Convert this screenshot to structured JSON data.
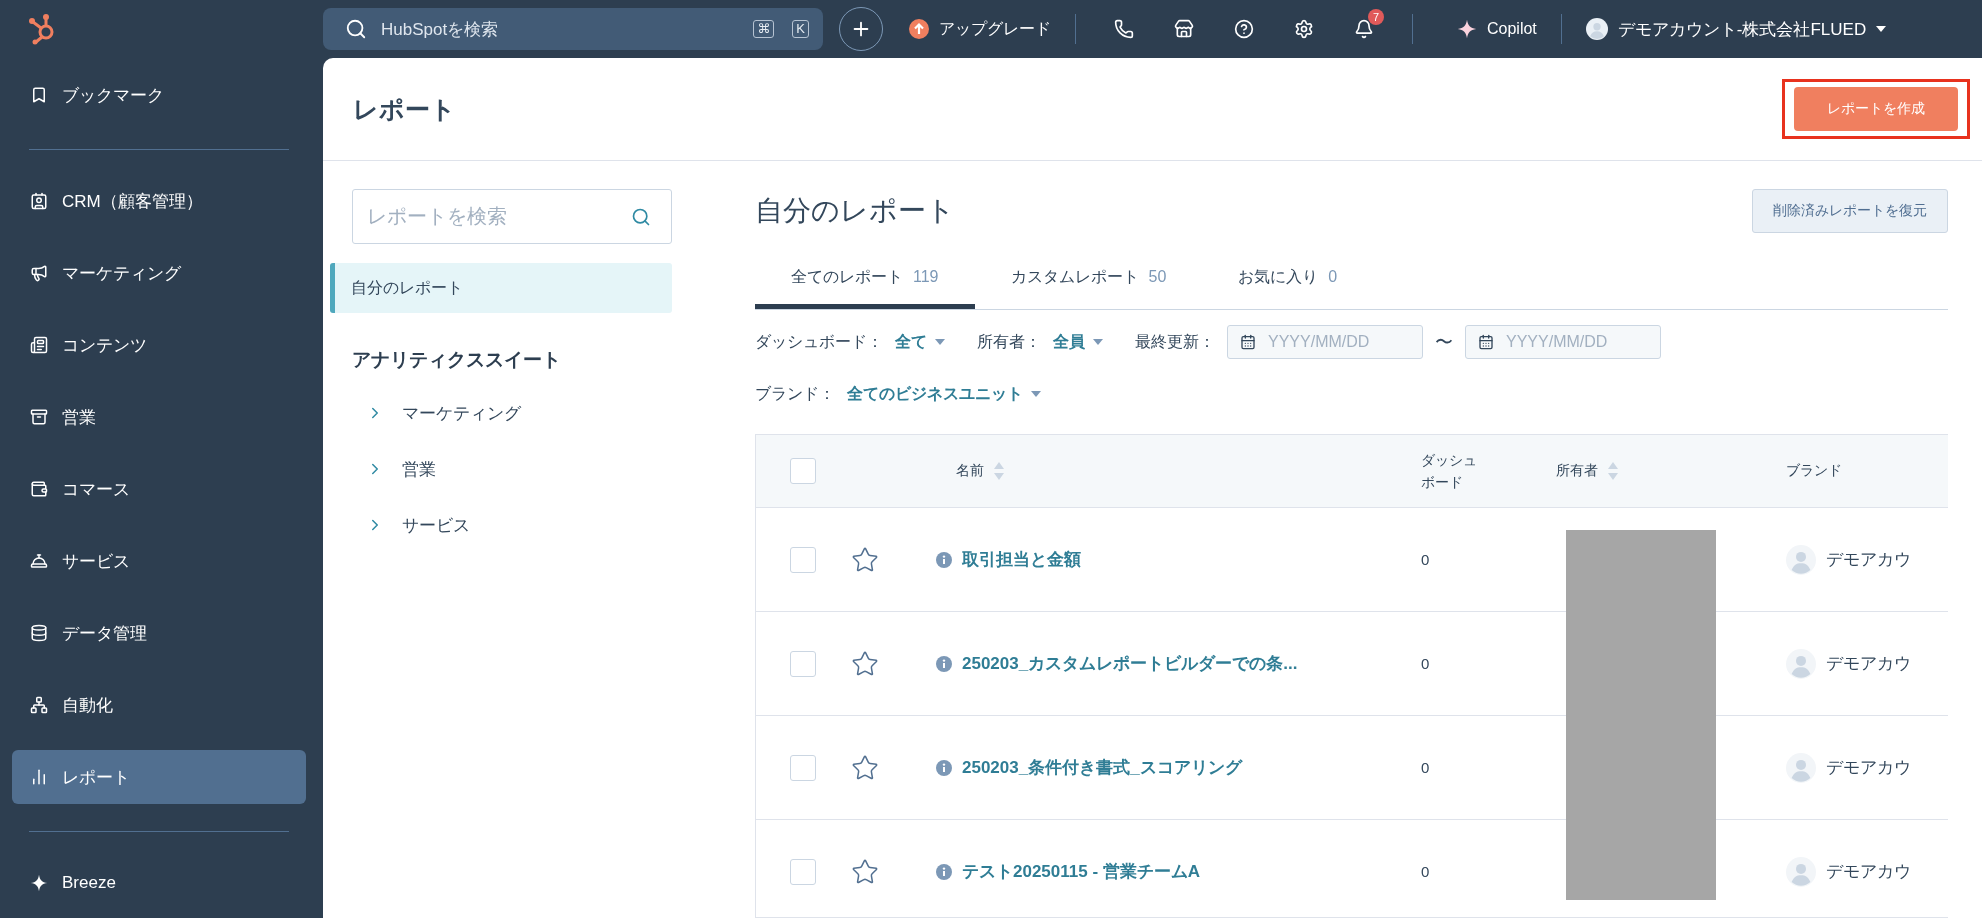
{
  "topbar": {
    "search": {
      "placeholder": "HubSpotを検索",
      "keys": [
        "⌘",
        "K"
      ]
    },
    "upgrade": "アップグレード",
    "notifications": "7",
    "copilot": "Copilot",
    "account": "デモアカウント-株式会社FLUED"
  },
  "sidebar": {
    "sections": [
      {
        "items": [
          {
            "label": "ブックマーク",
            "selected": false
          }
        ]
      },
      {
        "items": [
          {
            "label": "CRM（顧客管理）",
            "selected": false
          },
          {
            "label": "マーケティング",
            "selected": false
          },
          {
            "label": "コンテンツ",
            "selected": false
          },
          {
            "label": "営業",
            "selected": false
          },
          {
            "label": "コマース",
            "selected": false
          },
          {
            "label": "サービス",
            "selected": false
          },
          {
            "label": "データ管理",
            "selected": false
          },
          {
            "label": "自動化",
            "selected": false
          },
          {
            "label": "レポート",
            "selected": true
          }
        ]
      },
      {
        "items": [
          {
            "label": "Breeze",
            "selected": false
          }
        ]
      }
    ]
  },
  "page": {
    "title": "レポート",
    "create_button": {
      "label": "レポートを作成",
      "highlighted": true
    }
  },
  "left_panel": {
    "search": {
      "placeholder": "レポートを検索"
    },
    "nav": [
      {
        "label": "自分のレポート",
        "selected": true
      }
    ],
    "section_title": "アナリティクススイート",
    "tree": [
      {
        "label": "マーケティング",
        "expanded": false
      },
      {
        "label": "営業",
        "expanded": false
      },
      {
        "label": "サービス",
        "expanded": false
      }
    ]
  },
  "content": {
    "title": "自分のレポート",
    "restore_button": "削除済みレポートを復元",
    "tabs": [
      {
        "label": "全てのレポート",
        "count": "119",
        "selected": true
      },
      {
        "label": "カスタムレポート",
        "count": "50",
        "selected": false
      },
      {
        "label": "お気に入り",
        "count": "0",
        "selected": false
      }
    ],
    "filters": [
      {
        "label": "ダッシュボード：",
        "value": "全て"
      },
      {
        "label": "所有者：",
        "value": "全員"
      }
    ],
    "date_filter": {
      "label": "最終更新：",
      "from_placeholder": "YYYY/MM/DD",
      "separator": "〜",
      "to_placeholder": "YYYY/MM/DD"
    },
    "brand_filter": {
      "label": "ブランド：",
      "value": "全てのビジネスユニット"
    },
    "table": {
      "header_checked": false,
      "columns": [
        {
          "label": "名前",
          "sortable": true
        },
        {
          "label": "ダッシュボード",
          "sortable": false
        },
        {
          "label": "所有者",
          "sortable": true
        },
        {
          "label": "ブランド",
          "sortable": false
        }
      ],
      "rows": [
        {
          "name": "取引担当と金額",
          "dashboard": "0",
          "brand": "デモアカウ",
          "checked": false,
          "starred": false
        },
        {
          "name": "250203_カスタムレポートビルダーでの条...",
          "dashboard": "0",
          "brand": "デモアカウ",
          "checked": false,
          "starred": false
        },
        {
          "name": "250203_条件付き書式_スコアリング",
          "dashboard": "0",
          "brand": "デモアカウ",
          "checked": false,
          "starred": false
        },
        {
          "name": "テスト20250115 - 営業チームA",
          "dashboard": "0",
          "brand": "デモアカウ",
          "checked": false,
          "starred": false
        }
      ]
    }
  }
}
